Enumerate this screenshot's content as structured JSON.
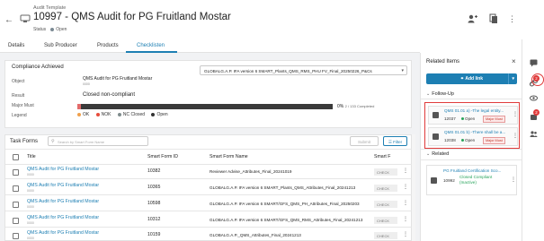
{
  "header": {
    "subtitle": "Audit Template",
    "title": "10997 - QMS Audit for PG Fruitland Mostar",
    "status_label": "Status",
    "status_value": "Open"
  },
  "tabs": [
    {
      "label": "Details"
    },
    {
      "label": "Sub Producer"
    },
    {
      "label": "Products"
    },
    {
      "label": "Checklisten"
    }
  ],
  "compliance": {
    "title": "Compliance Achieved",
    "object_label": "Object",
    "object_value": "QMS Audit for PG Fruitland Mostar",
    "object_sub": "0000",
    "select_value": "GLOBALG.A.P. IFA version 6 SMART_Plants_QMS_RMS_PHU FV_Final_20250226_P&Cs",
    "result_label": "Result",
    "result_value": "Closed non-compliant",
    "major_must_label": "Major Must",
    "progress_percent": 0,
    "progress_text": "0%",
    "progress_sub": "2 / 133 Completed",
    "legend_label": "Legend",
    "legend": [
      {
        "label": "OK",
        "color": "#f0a04b"
      },
      {
        "label": "NOK",
        "color": "#e74c3c"
      },
      {
        "label": "NC Closed",
        "color": "#7f8c8d"
      },
      {
        "label": "Open",
        "color": "#333333"
      }
    ]
  },
  "task_forms": {
    "title": "Task Forms",
    "search_placeholder": "Search by Smart Form Name",
    "submit_label": "Submit",
    "filter_label": "Filter",
    "columns": [
      "Title",
      "Smart Form ID",
      "Smart Form Name",
      "Smart F"
    ],
    "rows": [
      {
        "title": "QMS Audit for PG Fruitland Mostar",
        "sub": "0000",
        "id": "10382",
        "name": "Reviewer Advise_Attributes_Final_20241019",
        "btn": "CHECK"
      },
      {
        "title": "QMS Audit for PG Fruitland Mostar",
        "sub": "0000",
        "id": "10365",
        "name": "GLOBALG.A.P. IFA version 6 SMART_Plants_QMS_Attributes_Final_20241213",
        "btn": "CHECK"
      },
      {
        "title": "QMS Audit for PG Fruitland Mostar",
        "sub": "0000",
        "id": "10598",
        "name": "GLOBALG.A.P. IFA version 6 SMART/GFS_QMS_PH_Attributes_Final_20250203",
        "btn": "CHECK"
      },
      {
        "title": "QMS Audit for PG Fruitland Mostar",
        "sub": "0000",
        "id": "10312",
        "name": "GLOBALG.A.P. IFA version 6 SMART/GFS_QMS_RMS_Attributes_Final_20241213",
        "btn": "CHECK"
      },
      {
        "title": "QMS Audit for PG Fruitland Mostar",
        "sub": "0000",
        "id": "10159",
        "name": "GLOBALG.A.P._QMS_Attributes_Final_20241213",
        "btn": "CHECK"
      }
    ]
  },
  "related": {
    "title": "Related Items",
    "add_link": "Add link",
    "followup_title": "Follow-Up",
    "followup": [
      {
        "title": "QMS 01.01 a) -The legal entity...",
        "id": "12037",
        "status": "Open",
        "badge": "Major Must"
      },
      {
        "title": "QMS 01.01 b) -There shall be a...",
        "id": "12038",
        "status": "Open",
        "badge": "Major Must"
      }
    ],
    "related_title": "Related",
    "related_items": [
      {
        "title": "PG Fruitland Certification Sco...",
        "id": "10992",
        "status": "Closed Compliant (Inactive)"
      }
    ]
  },
  "rail": {
    "badge1": "2",
    "badge2": "2"
  }
}
